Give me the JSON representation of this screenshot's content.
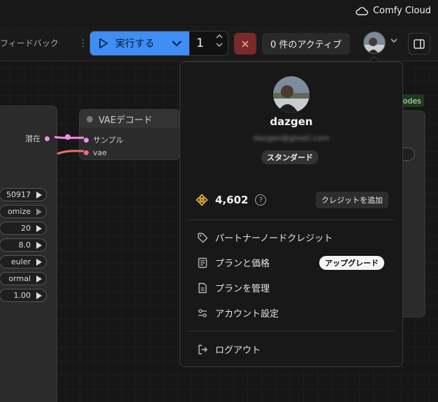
{
  "brand": {
    "name": "Comfy Cloud"
  },
  "toolbar": {
    "feedback_label": "フィードバック",
    "run_label": "実行する",
    "batch_count": "1",
    "queue_label": "0 件のアクティブ"
  },
  "nodes": {
    "vae_decode": {
      "title": "VAEデコード",
      "inputs": [
        "サンプル",
        "vae"
      ],
      "input_colors": [
        "#f08fe8",
        "#f06e6e"
      ]
    },
    "sampler": {
      "output_label": "潜在",
      "widgets": [
        "50917",
        "omize",
        "20",
        "8.0",
        "euler",
        "ormal",
        "1.00"
      ]
    },
    "right_tag": "odes"
  },
  "account_menu": {
    "username": "dazgen",
    "email": "dazgen@gmail.com",
    "plan": "スタンダード",
    "credits": "4,602",
    "help_symbol": "?",
    "add_credits_label": "クレジットを追加",
    "items": [
      {
        "label": "パートナーノードクレジット",
        "icon": "tag-icon"
      },
      {
        "label": "プランと価格",
        "icon": "receipt-icon",
        "badge": "アップグレード"
      },
      {
        "label": "プランを管理",
        "icon": "document-icon"
      },
      {
        "label": "アカウント設定",
        "icon": "sliders-icon"
      }
    ],
    "logout_label": "ログアウト"
  },
  "colors": {
    "accent": "#3e8ef5",
    "cancel": "#7a2a2a",
    "credit_icon": "#f0b43c",
    "wire_pink": "#f08fe8",
    "wire_red": "#f06e6e"
  }
}
